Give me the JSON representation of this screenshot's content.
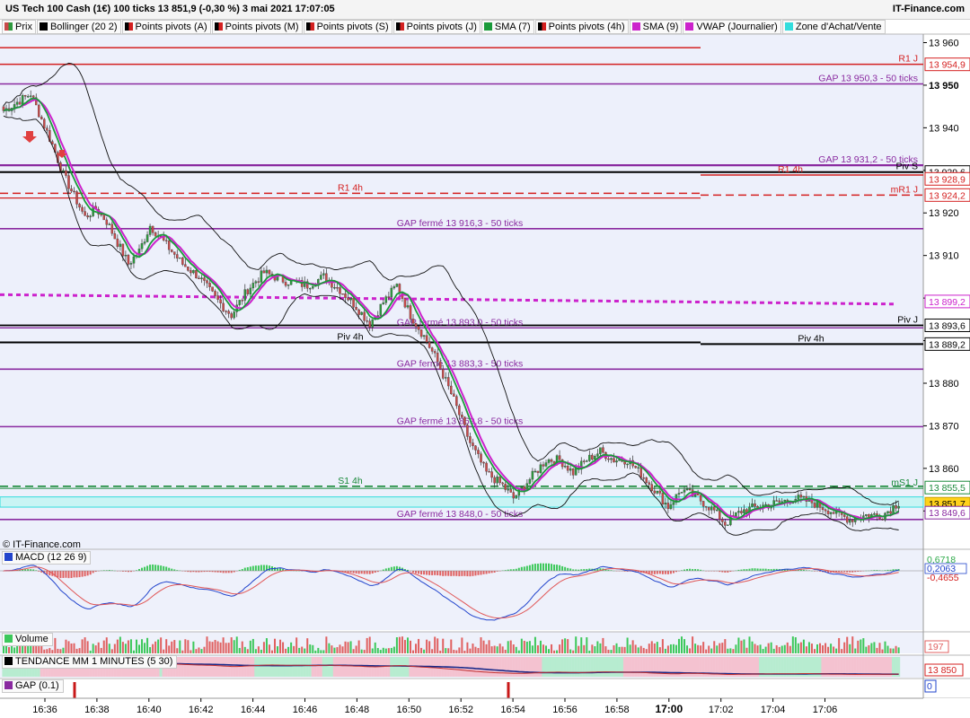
{
  "header": {
    "title": "US Tech 100 Cash (1€) 100 ticks 13 851,9 (-0,30 %) 3 mai 2021 17:07:05",
    "brand": "IT-Finance.com"
  },
  "legend": [
    {
      "label": "Prix",
      "color": "#c94a4a",
      "color2": "#2e9a3e"
    },
    {
      "label": "Bollinger (20 2)",
      "color": "#000000"
    },
    {
      "label": "Points pivots (A)",
      "color": "#000000",
      "color2": "#d42020"
    },
    {
      "label": "Points pivots (M)",
      "color": "#000000",
      "color2": "#d42020"
    },
    {
      "label": "Points pivots (S)",
      "color": "#000000",
      "color2": "#d42020"
    },
    {
      "label": "Points pivots (J)",
      "color": "#000000",
      "color2": "#d42020"
    },
    {
      "label": "SMA (7)",
      "color": "#1a9a3a"
    },
    {
      "label": "Points pivots (4h)",
      "color": "#000000",
      "color2": "#d42020"
    },
    {
      "label": "SMA (9)",
      "color": "#cc22cc"
    },
    {
      "label": "VWAP (Journalier)",
      "color": "#cc22cc"
    },
    {
      "label": "Zone d'Achat/Vente",
      "color": "#33dddd"
    }
  ],
  "copyright": "© IT-Finance.com",
  "colors": {
    "up": "#2e9a3e",
    "down": "#c94a4a",
    "gap": "#8a2aa0",
    "pivot": "#000000",
    "resist": "#d42020",
    "support": "#1a8a3a",
    "vwap": "#cc22cc",
    "zone": "#33dddd",
    "macd": "#2244cc",
    "signal": "#e05555",
    "hist_pos": "#3cc85a",
    "hist_neg": "#e06060"
  },
  "chart_data": {
    "type": "candlestick",
    "ylim": [
      13841,
      13962
    ],
    "yticks": [
      "13 960",
      "13 950",
      "13 940",
      "13 930",
      "13 920",
      "13 910",
      "13 900",
      "13 890",
      "13 880",
      "13 870",
      "13 860",
      "13 850"
    ],
    "xticks": [
      "16:36",
      "16:38",
      "16:40",
      "16:42",
      "16:44",
      "16:46",
      "16:48",
      "16:50",
      "16:52",
      "16:54",
      "16:56",
      "16:58",
      "17:00",
      "17:02",
      "17:04",
      "17:06"
    ],
    "bold_xtick": "17:00",
    "close_profile": [
      [
        0,
        13944
      ],
      [
        5,
        13946
      ],
      [
        10,
        13948
      ],
      [
        14,
        13942
      ],
      [
        18,
        13936
      ],
      [
        22,
        13929
      ],
      [
        26,
        13924
      ],
      [
        30,
        13919
      ],
      [
        34,
        13921
      ],
      [
        38,
        13918
      ],
      [
        42,
        13913
      ],
      [
        46,
        13908
      ],
      [
        50,
        13911
      ],
      [
        54,
        13917
      ],
      [
        58,
        13914
      ],
      [
        62,
        13911
      ],
      [
        66,
        13908
      ],
      [
        72,
        13905
      ],
      [
        78,
        13900
      ],
      [
        84,
        13896
      ],
      [
        90,
        13902
      ],
      [
        96,
        13906
      ],
      [
        104,
        13904
      ],
      [
        112,
        13903
      ],
      [
        118,
        13905
      ],
      [
        124,
        13902
      ],
      [
        130,
        13898
      ],
      [
        135,
        13894
      ],
      [
        140,
        13899
      ],
      [
        145,
        13903
      ],
      [
        150,
        13896
      ],
      [
        155,
        13891
      ],
      [
        160,
        13885
      ],
      [
        166,
        13876
      ],
      [
        172,
        13866
      ],
      [
        178,
        13859
      ],
      [
        184,
        13856
      ],
      [
        188,
        13853
      ],
      [
        192,
        13856
      ],
      [
        196,
        13859
      ],
      [
        200,
        13862
      ],
      [
        205,
        13862
      ],
      [
        210,
        13859
      ],
      [
        215,
        13862
      ],
      [
        220,
        13864
      ],
      [
        225,
        13862
      ],
      [
        230,
        13862
      ],
      [
        236,
        13858
      ],
      [
        240,
        13855
      ],
      [
        245,
        13851
      ],
      [
        250,
        13855
      ],
      [
        256,
        13853
      ],
      [
        262,
        13850
      ],
      [
        266,
        13847
      ],
      [
        272,
        13850
      ],
      [
        278,
        13851
      ],
      [
        286,
        13852
      ],
      [
        292,
        13853
      ],
      [
        298,
        13852
      ],
      [
        305,
        13850
      ],
      [
        312,
        13848
      ],
      [
        318,
        13849
      ],
      [
        324,
        13849
      ],
      [
        330,
        13852
      ]
    ],
    "levels": [
      {
        "label": "R1 J",
        "value": 13954.9,
        "color": "resist",
        "style": "solid",
        "width": 1.5,
        "labelPos": "right-edge",
        "xfrom": 0
      },
      {
        "label": "",
        "value": 13958.8,
        "color": "resist",
        "style": "solid",
        "width": 1.5,
        "xfrom": 0,
        "xto": 780
      },
      {
        "label": "GAP 13 950,3 - 50 ticks",
        "value": 13950.3,
        "color": "gap",
        "style": "solid",
        "width": 1.6,
        "labelPos": "right-edge",
        "xfrom": 0
      },
      {
        "label": "GAP 13 931,2 - 50 ticks",
        "value": 13931.2,
        "color": "gap",
        "style": "solid",
        "width": 2.2,
        "labelPos": "right-edge",
        "xfrom": 0
      },
      {
        "label": "Piv S",
        "value": 13929.6,
        "color": "pivot",
        "style": "solid",
        "width": 2,
        "labelPos": "right-edge",
        "xfrom": 0
      },
      {
        "label": "R1 4h",
        "value": 13928.9,
        "color": "resist",
        "style": "solid",
        "width": 1.5,
        "labelPos": "at-880",
        "xfrom": 780
      },
      {
        "label": "R1 4h",
        "value": 13924.6,
        "color": "resist",
        "style": "dashed",
        "width": 1.5,
        "labelPos": "at-390",
        "xfrom": 0,
        "xto": 780
      },
      {
        "label": "",
        "value": 13923.5,
        "color": "resist",
        "style": "solid",
        "width": 1.2,
        "xfrom": 0,
        "xto": 780
      },
      {
        "label": "mR1 J",
        "value": 13924.2,
        "color": "resist",
        "style": "dashed",
        "width": 1.5,
        "labelPos": "right-edge",
        "xfrom": 780
      },
      {
        "label": "GAP fermé 13 916,3 - 50 ticks",
        "value": 13916.3,
        "color": "gap",
        "style": "solid",
        "width": 1.6,
        "labelPos": "at-512",
        "xfrom": 0
      },
      {
        "label": "Piv J",
        "value": 13893.6,
        "color": "pivot",
        "style": "solid",
        "width": 1.8,
        "labelPos": "right-edge",
        "xfrom": 0
      },
      {
        "label": "GAP fermé 13 893,0 - 50 ticks",
        "value": 13893.0,
        "color": "gap",
        "style": "solid",
        "width": 1.4,
        "labelPos": "at-512",
        "xfrom": 0
      },
      {
        "label": "Piv 4h",
        "value": 13889.6,
        "color": "pivot",
        "style": "solid",
        "width": 2,
        "labelPos": "at-390",
        "xfrom": 0,
        "xto": 780
      },
      {
        "label": "Piv 4h",
        "value": 13889.2,
        "color": "pivot",
        "style": "solid",
        "width": 2,
        "labelPos": "at-903",
        "xfrom": 780
      },
      {
        "label": "GAP fermé 13 883,3 - 50 ticks",
        "value": 13883.3,
        "color": "gap",
        "style": "solid",
        "width": 1.6,
        "labelPos": "at-512",
        "xfrom": 0
      },
      {
        "label": "GAP fermé 13 869,8 - 50 ticks",
        "value": 13869.8,
        "color": "gap",
        "style": "solid",
        "width": 1.6,
        "labelPos": "at-512",
        "xfrom": 0
      },
      {
        "label": "S1 4h",
        "value": 13855.8,
        "color": "support",
        "style": "dashed",
        "width": 1.6,
        "labelPos": "at-390",
        "xfrom": 0
      },
      {
        "label": "mS1 J",
        "value": 13855.3,
        "color": "support",
        "style": "solid",
        "width": 1,
        "labelPos": "right-edge",
        "xfrom": 0
      },
      {
        "label": "GAP fermé 13 848,0 - 50 ticks",
        "value": 13848.0,
        "color": "gap",
        "style": "solid",
        "width": 1.6,
        "labelPos": "at-512",
        "xfrom": 0
      }
    ],
    "zone": [
      13850.9,
      13853.3
    ],
    "vwap": {
      "from": [
        0,
        13900.8
      ],
      "to": [
        995,
        13898.6
      ]
    },
    "price_labels": [
      {
        "text": "13 954,9",
        "value": 13954.9,
        "bg": "#ffffff",
        "fg": "#d42020",
        "border": "#d42020"
      },
      {
        "text": "13 929,6",
        "value": 13929.6,
        "bg": "#ffffff",
        "fg": "#000000",
        "border": "#000000"
      },
      {
        "text": "13 928,9",
        "value": 13928.0,
        "bg": "#ffffff",
        "fg": "#d42020",
        "border": "#d42020"
      },
      {
        "text": "13 924,2",
        "value": 13924.2,
        "bg": "#ffffff",
        "fg": "#d42020",
        "border": "#d42020"
      },
      {
        "text": "13 899,2",
        "value": 13899.2,
        "bg": "#ffffff",
        "fg": "#cc22cc",
        "border": "#cc22cc"
      },
      {
        "text": "13 893,6",
        "value": 13893.6,
        "bg": "#ffffff",
        "fg": "#000000",
        "border": "#000000"
      },
      {
        "text": "13 889,2",
        "value": 13889.2,
        "bg": "#ffffff",
        "fg": "#000000",
        "border": "#000000"
      },
      {
        "text": "13 855,5",
        "value": 13855.5,
        "bg": "#ffffff",
        "fg": "#1a8a3a",
        "border": "#1a8a3a"
      },
      {
        "text": "13 851,7",
        "value": 13851.7,
        "bg": "#ffd21a",
        "fg": "#000000",
        "border": "#caa000"
      },
      {
        "text": "13 849,6",
        "value": 13849.6,
        "bg": "#ffffff",
        "fg": "#8a2aa0",
        "border": "#8a2aa0"
      }
    ],
    "macd": {
      "label": "MACD (12 26 9)",
      "values": [
        {
          "text": "0,6718",
          "fg": "#2eaa4a"
        },
        {
          "text": "0,2063",
          "fg": "#2244cc"
        },
        {
          "text": "-0,4655",
          "fg": "#d42020"
        }
      ]
    },
    "volume": {
      "label": "Volume",
      "value": "197"
    },
    "tendance": {
      "label": "TENDANCE MM 1 MINUTES (5 30)",
      "value": "13 850"
    },
    "gap_panel": {
      "label": "GAP (0.1)",
      "value": "0"
    }
  }
}
